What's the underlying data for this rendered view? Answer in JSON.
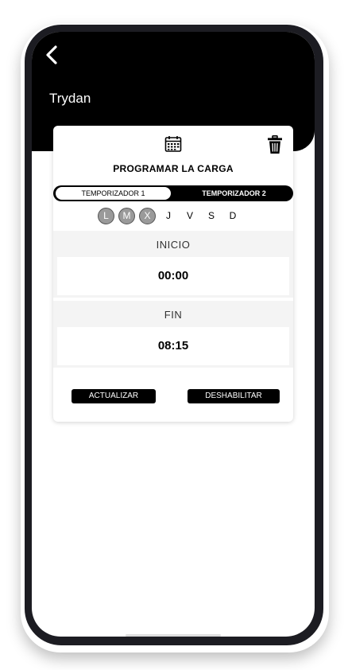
{
  "header": {
    "title": "Trydan"
  },
  "card": {
    "heading": "PROGRAMAR LA CARGA",
    "tabs": [
      {
        "label": "TEMPORIZADOR 1",
        "active": true
      },
      {
        "label": "TEMPORIZADOR 2",
        "active": false
      }
    ],
    "days": [
      {
        "label": "L",
        "selected": true
      },
      {
        "label": "M",
        "selected": true
      },
      {
        "label": "X",
        "selected": true
      },
      {
        "label": "J",
        "selected": false
      },
      {
        "label": "V",
        "selected": false
      },
      {
        "label": "S",
        "selected": false
      },
      {
        "label": "D",
        "selected": false
      }
    ],
    "start": {
      "label": "INICIO",
      "value": "00:00"
    },
    "end": {
      "label": "FIN",
      "value": "08:15"
    },
    "update_label": "ACTUALIZAR",
    "disable_label": "DESHABILITAR"
  },
  "icons": {
    "back": "chevron-left-icon",
    "calendar": "calendar-icon",
    "delete": "trash-icon"
  },
  "colors": {
    "header": "#000000",
    "accent": "#000000",
    "selected_day": "#9a9a9a",
    "section_bg": "#f4f4f4"
  }
}
